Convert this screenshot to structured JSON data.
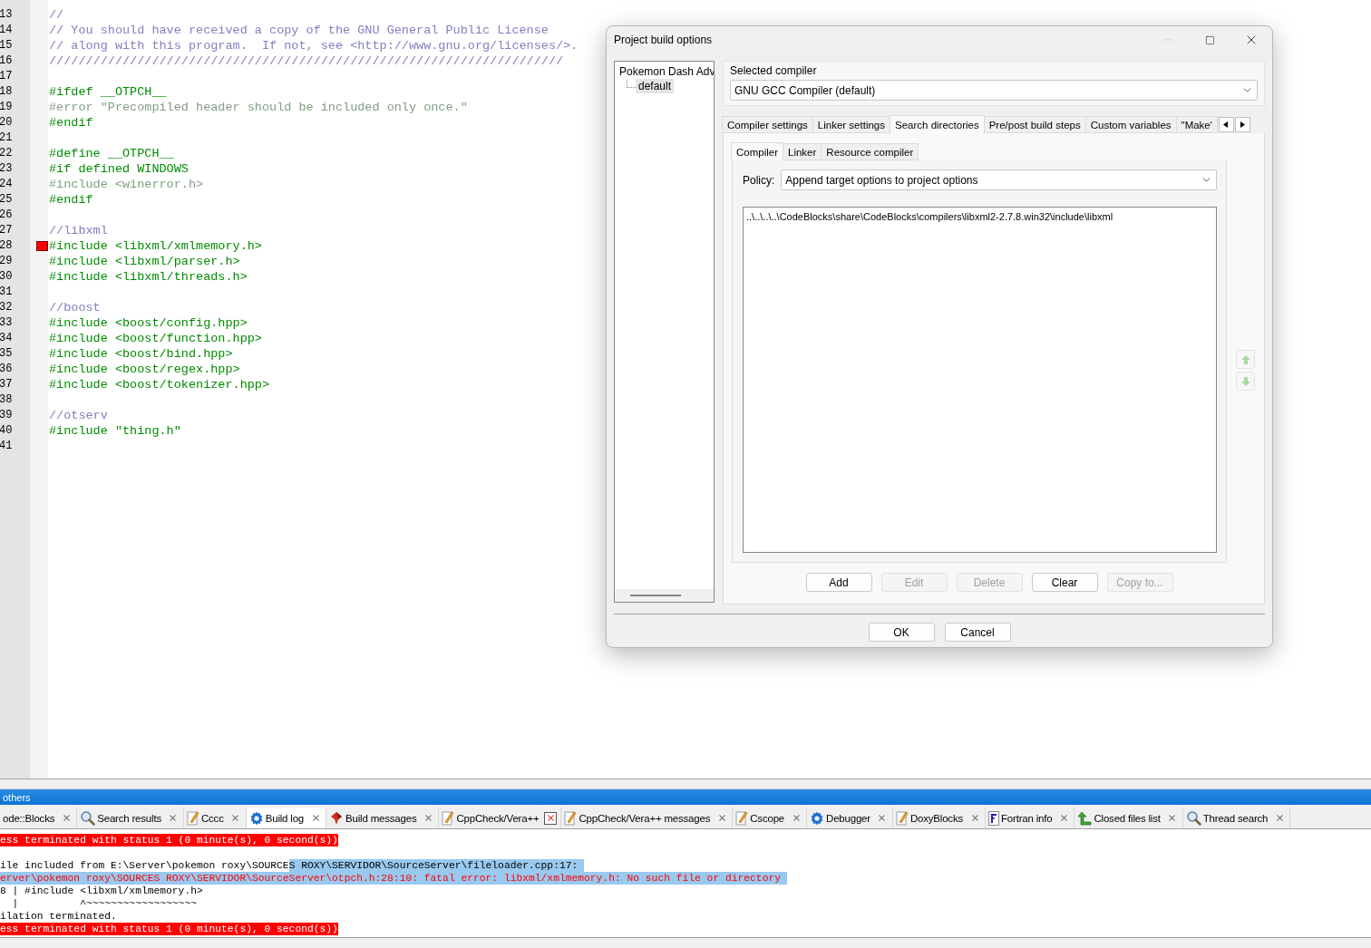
{
  "editor": {
    "lines": [
      {
        "number": "13",
        "text": "//",
        "kind": "comment",
        "marker": false
      },
      {
        "number": "14",
        "text": "// You should have received a copy of the GNU General Public License",
        "kind": "comment",
        "marker": false
      },
      {
        "number": "15",
        "text": "// along with this program.  If not, see <http://www.gnu.org/licenses/>.",
        "kind": "comment",
        "marker": false
      },
      {
        "number": "16",
        "text": "//////////////////////////////////////////////////////////////////////",
        "kind": "comment",
        "marker": false
      },
      {
        "number": "17",
        "kind": "blank",
        "marker": false
      },
      {
        "number": "18",
        "text": "#ifdef __OTPCH__",
        "kind": "directive",
        "marker": false
      },
      {
        "number": "19",
        "text": "#error \"Precompiled header should be included only once.\"",
        "kind": "inactive",
        "marker": false
      },
      {
        "number": "20",
        "text": "#endif",
        "kind": "directive",
        "marker": false
      },
      {
        "number": "21",
        "kind": "blank",
        "marker": false
      },
      {
        "number": "22",
        "text": "#define __OTPCH__",
        "kind": "directive",
        "marker": false
      },
      {
        "number": "23",
        "text": "#if defined WINDOWS",
        "kind": "directive",
        "marker": false
      },
      {
        "number": "24",
        "text": "#include <winerror.h>",
        "kind": "inactive",
        "marker": false
      },
      {
        "number": "25",
        "text": "#endif",
        "kind": "directive",
        "marker": false
      },
      {
        "number": "26",
        "kind": "blank",
        "marker": false
      },
      {
        "number": "27",
        "text": "//libxml",
        "kind": "comment",
        "marker": false
      },
      {
        "number": "28",
        "text": "#include <libxml/xmlmemory.h>",
        "kind": "directive",
        "marker": true
      },
      {
        "number": "29",
        "text": "#include <libxml/parser.h>",
        "kind": "directive",
        "marker": false
      },
      {
        "number": "30",
        "text": "#include <libxml/threads.h>",
        "kind": "directive",
        "marker": false
      },
      {
        "number": "31",
        "kind": "blank",
        "marker": false
      },
      {
        "number": "32",
        "text": "//boost",
        "kind": "comment",
        "marker": false
      },
      {
        "number": "33",
        "text": "#include <boost/config.hpp>",
        "kind": "directive",
        "marker": false
      },
      {
        "number": "34",
        "text": "#include <boost/function.hpp>",
        "kind": "directive",
        "marker": false
      },
      {
        "number": "35",
        "text": "#include <boost/bind.hpp>",
        "kind": "directive",
        "marker": false
      },
      {
        "number": "36",
        "text": "#include <boost/regex.hpp>",
        "kind": "directive",
        "marker": false
      },
      {
        "number": "37",
        "text": "#include <boost/tokenizer.hpp>",
        "kind": "directive",
        "marker": false
      },
      {
        "number": "38",
        "kind": "blank",
        "marker": false
      },
      {
        "number": "39",
        "text": "//otserv",
        "kind": "comment",
        "marker": false
      },
      {
        "number": "40",
        "text": "#include \"thing.h\"",
        "kind": "directive",
        "marker": false
      },
      {
        "number": "41",
        "kind": "blank",
        "marker": false
      }
    ]
  },
  "dialog": {
    "title": "Project build options",
    "tree": {
      "root": "Pokemon Dash Adv",
      "children": [
        {
          "label": "default",
          "selected": true
        }
      ]
    },
    "compiler_group": {
      "label": "Selected compiler",
      "value": "GNU GCC Compiler (default)"
    },
    "tabs": [
      {
        "label": "Compiler settings",
        "selected": false
      },
      {
        "label": "Linker settings",
        "selected": false
      },
      {
        "label": "Search directories",
        "selected": true
      },
      {
        "label": "Pre/post build steps",
        "selected": false
      },
      {
        "label": "Custom variables",
        "selected": false
      },
      {
        "label": "\"Make'",
        "selected": false
      }
    ],
    "sub_tabs": [
      {
        "label": "Compiler",
        "selected": true
      },
      {
        "label": "Linker",
        "selected": false
      },
      {
        "label": "Resource compiler",
        "selected": false
      }
    ],
    "policy": {
      "label": "Policy:",
      "value": "Append target options to project options"
    },
    "directories": [
      {
        "text": "..\\..\\..\\..\\CodeBlocks\\share\\CodeBlocks\\compilers\\libxml2-2.7.8.win32\\include\\libxml"
      }
    ],
    "actions": [
      {
        "label": "Add",
        "disabled": false
      },
      {
        "label": "Edit",
        "disabled": true
      },
      {
        "label": "Delete",
        "disabled": true
      },
      {
        "label": "Clear",
        "disabled": false
      },
      {
        "label": "Copy to...",
        "disabled": true
      }
    ],
    "buttons": [
      "OK",
      "Cancel"
    ]
  },
  "bottom_panel": {
    "title": "others",
    "tabs": [
      {
        "label": "ode::Blocks",
        "kind": "none",
        "selected": false,
        "close_hovered": false
      },
      {
        "label": "Search results",
        "kind": "search",
        "selected": false,
        "close_hovered": false
      },
      {
        "label": "Cccc",
        "kind": "note",
        "selected": false,
        "close_hovered": false
      },
      {
        "label": "Build log",
        "kind": "gear",
        "selected": true,
        "close_hovered": false
      },
      {
        "label": "Build messages",
        "kind": "pin",
        "selected": false,
        "close_hovered": false
      },
      {
        "label": "CppCheck/Vera++",
        "kind": "note",
        "selected": false,
        "close_hovered": true
      },
      {
        "label": "CppCheck/Vera++ messages",
        "kind": "note",
        "selected": false,
        "close_hovered": false
      },
      {
        "label": "Cscope",
        "kind": "note",
        "selected": false,
        "close_hovered": false
      },
      {
        "label": "Debugger",
        "kind": "gear",
        "selected": false,
        "close_hovered": false
      },
      {
        "label": "DoxyBlocks",
        "kind": "note",
        "selected": false,
        "close_hovered": false
      },
      {
        "label": "Fortran info",
        "kind": "doc",
        "selected": false,
        "close_hovered": false
      },
      {
        "label": "Closed files list",
        "kind": "arrow",
        "selected": false,
        "close_hovered": false
      },
      {
        "label": "Thread search",
        "kind": "search",
        "selected": false,
        "close_hovered": false
      }
    ],
    "log": [
      {
        "kind": "status",
        "segments": [
          {
            "text": "ess terminated with status 1 (0 minute(s), 0 second(s))",
            "selected": false
          }
        ]
      },
      {
        "kind": "blank"
      },
      {
        "kind": "info",
        "segments": [
          {
            "text": "ile included from E:\\Server\\pokemon roxy\\SOURCE",
            "selected": false
          },
          {
            "text": "S ROXY\\SERVIDOR\\SourceServer\\fileloader.cpp:17: ",
            "selected": true
          }
        ]
      },
      {
        "kind": "error",
        "segments": [
          {
            "text": "erver\\pokemon roxy\\SOURCES ROXY\\SERVIDOR\\SourceServer\\otpch.h:28:10: fatal error: libxml/xmlmemory.h: No such file or directory ",
            "selected": true
          }
        ]
      },
      {
        "kind": "info",
        "segments": [
          {
            "text": "8 | #include <libxml/xmlmemory.h>",
            "selected": false
          }
        ]
      },
      {
        "kind": "info",
        "segments": [
          {
            "text": "  |          ^~~~~~~~~~~~~~~~~~~",
            "selected": false
          }
        ]
      },
      {
        "kind": "info",
        "segments": [
          {
            "text": "ilation terminated.",
            "selected": false
          }
        ]
      },
      {
        "kind": "status",
        "segments": [
          {
            "text": "ess terminated with status 1 (0 minute(s), 0 second(s))",
            "selected": false
          }
        ]
      }
    ]
  }
}
